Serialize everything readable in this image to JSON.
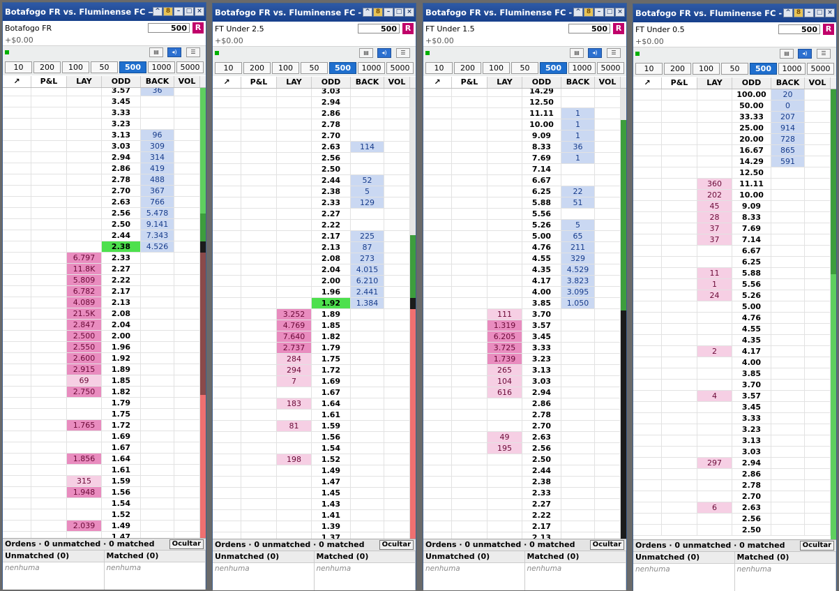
{
  "panels": [
    {
      "title": "Botafogo FR vs. Fluminense FC — Mat...",
      "market": "Botafogo FR",
      "pl": "+$0.00",
      "stake": "500",
      "firstOdd": "3.57",
      "rows": [
        [
          "3.57",
          "",
          "36"
        ],
        [
          "3.45",
          "",
          ""
        ],
        [
          "3.33",
          "",
          ""
        ],
        [
          "3.23",
          "",
          ""
        ],
        [
          "3.13",
          "",
          "96"
        ],
        [
          "3.03",
          "",
          "309"
        ],
        [
          "2.94",
          "",
          "314"
        ],
        [
          "2.86",
          "",
          "419"
        ],
        [
          "2.78",
          "",
          "488"
        ],
        [
          "2.70",
          "",
          "367"
        ],
        [
          "2.63",
          "",
          "766"
        ],
        [
          "2.56",
          "",
          "5.478"
        ],
        [
          "2.50",
          "",
          "9.141"
        ],
        [
          "2.44",
          "",
          "7.343"
        ],
        [
          "2.38",
          "",
          "4.526",
          "cur"
        ],
        [
          "2.33",
          "6.797",
          ""
        ],
        [
          "2.27",
          "11.8K",
          ""
        ],
        [
          "2.22",
          "5.809",
          ""
        ],
        [
          "2.17",
          "6.782",
          ""
        ],
        [
          "2.13",
          "4.089",
          ""
        ],
        [
          "2.08",
          "21.5K",
          ""
        ],
        [
          "2.04",
          "2.847",
          ""
        ],
        [
          "2.00",
          "2.500",
          ""
        ],
        [
          "1.96",
          "2.550",
          ""
        ],
        [
          "1.92",
          "2.600",
          ""
        ],
        [
          "1.89",
          "2.915",
          ""
        ],
        [
          "1.85",
          "69",
          ""
        ],
        [
          "1.82",
          "2.750",
          ""
        ],
        [
          "1.79",
          "",
          ""
        ],
        [
          "1.75",
          "",
          ""
        ],
        [
          "1.72",
          "1.765",
          ""
        ],
        [
          "1.69",
          "",
          ""
        ],
        [
          "1.67",
          "",
          ""
        ],
        [
          "1.64",
          "1.856",
          ""
        ],
        [
          "1.61",
          "",
          ""
        ],
        [
          "1.59",
          "315",
          ""
        ],
        [
          "1.56",
          "1.948",
          ""
        ],
        [
          "1.54",
          "",
          ""
        ],
        [
          "1.52",
          "",
          ""
        ],
        [
          "1.49",
          "2.039",
          ""
        ],
        [
          "1.47",
          "",
          ""
        ]
      ]
    },
    {
      "title": "Botafogo FR vs. Fluminense FC - More...",
      "market": "FT Under 2.5",
      "pl": "+$0.00",
      "stake": "500",
      "rows": [
        [
          "3.03",
          "",
          ""
        ],
        [
          "2.94",
          "",
          ""
        ],
        [
          "2.86",
          "",
          ""
        ],
        [
          "2.78",
          "",
          ""
        ],
        [
          "2.70",
          "",
          ""
        ],
        [
          "2.63",
          "",
          "114"
        ],
        [
          "2.56",
          "",
          ""
        ],
        [
          "2.50",
          "",
          ""
        ],
        [
          "2.44",
          "",
          "52"
        ],
        [
          "2.38",
          "",
          "5"
        ],
        [
          "2.33",
          "",
          "129"
        ],
        [
          "2.27",
          "",
          ""
        ],
        [
          "2.22",
          "",
          ""
        ],
        [
          "2.17",
          "",
          "225"
        ],
        [
          "2.13",
          "",
          "87"
        ],
        [
          "2.08",
          "",
          "273"
        ],
        [
          "2.04",
          "",
          "4.015"
        ],
        [
          "2.00",
          "",
          "6.210"
        ],
        [
          "1.96",
          "",
          "2.441"
        ],
        [
          "1.92",
          "",
          "1.384",
          "cur"
        ],
        [
          "1.89",
          "3.252",
          ""
        ],
        [
          "1.85",
          "4.769",
          ""
        ],
        [
          "1.82",
          "7.640",
          ""
        ],
        [
          "1.79",
          "2.737",
          ""
        ],
        [
          "1.75",
          "284",
          ""
        ],
        [
          "1.72",
          "294",
          ""
        ],
        [
          "1.69",
          "7",
          ""
        ],
        [
          "1.67",
          "",
          ""
        ],
        [
          "1.64",
          "183",
          ""
        ],
        [
          "1.61",
          "",
          ""
        ],
        [
          "1.59",
          "81",
          ""
        ],
        [
          "1.56",
          "",
          ""
        ],
        [
          "1.54",
          "",
          ""
        ],
        [
          "1.52",
          "198",
          ""
        ],
        [
          "1.49",
          "",
          ""
        ],
        [
          "1.47",
          "",
          ""
        ],
        [
          "1.45",
          "",
          ""
        ],
        [
          "1.43",
          "",
          ""
        ],
        [
          "1.41",
          "",
          ""
        ],
        [
          "1.39",
          "",
          ""
        ],
        [
          "1.37",
          "",
          ""
        ]
      ]
    },
    {
      "title": "Botafogo FR vs. Fluminense FC - More...",
      "market": "FT Under 1.5",
      "pl": "+$0.00",
      "stake": "500",
      "rows": [
        [
          "14.29",
          "",
          ""
        ],
        [
          "12.50",
          "",
          ""
        ],
        [
          "11.11",
          "",
          "1"
        ],
        [
          "10.00",
          "",
          "1"
        ],
        [
          "9.09",
          "",
          "1"
        ],
        [
          "8.33",
          "",
          "36"
        ],
        [
          "7.69",
          "",
          "1"
        ],
        [
          "7.14",
          "",
          ""
        ],
        [
          "6.67",
          "",
          ""
        ],
        [
          "6.25",
          "",
          "22"
        ],
        [
          "5.88",
          "",
          "51"
        ],
        [
          "5.56",
          "",
          ""
        ],
        [
          "5.26",
          "",
          "5"
        ],
        [
          "5.00",
          "",
          "65"
        ],
        [
          "4.76",
          "",
          "211"
        ],
        [
          "4.55",
          "",
          "329"
        ],
        [
          "4.35",
          "",
          "4.529"
        ],
        [
          "4.17",
          "",
          "3.823"
        ],
        [
          "4.00",
          "",
          "3.095"
        ],
        [
          "3.85",
          "",
          "1.050"
        ],
        [
          "3.70",
          "111",
          ""
        ],
        [
          "3.57",
          "1.319",
          ""
        ],
        [
          "3.45",
          "6.205",
          ""
        ],
        [
          "3.33",
          "3.725",
          ""
        ],
        [
          "3.23",
          "1.739",
          ""
        ],
        [
          "3.13",
          "265",
          ""
        ],
        [
          "3.03",
          "104",
          ""
        ],
        [
          "2.94",
          "616",
          ""
        ],
        [
          "2.86",
          "",
          ""
        ],
        [
          "2.78",
          "",
          ""
        ],
        [
          "2.70",
          "",
          ""
        ],
        [
          "2.63",
          "49",
          ""
        ],
        [
          "2.56",
          "195",
          ""
        ],
        [
          "2.50",
          "",
          ""
        ],
        [
          "2.44",
          "",
          ""
        ],
        [
          "2.38",
          "",
          ""
        ],
        [
          "2.33",
          "",
          ""
        ],
        [
          "2.27",
          "",
          ""
        ],
        [
          "2.22",
          "",
          ""
        ],
        [
          "2.17",
          "",
          ""
        ],
        [
          "2.13",
          "",
          ""
        ]
      ]
    },
    {
      "title": "Botafogo FR vs. Fluminense FC - More...",
      "market": "FT Under 0.5",
      "pl": "+$0.00",
      "stake": "500",
      "rows": [
        [
          "100.00",
          "",
          "20"
        ],
        [
          "50.00",
          "",
          "0"
        ],
        [
          "33.33",
          "",
          "207"
        ],
        [
          "25.00",
          "",
          "914"
        ],
        [
          "20.00",
          "",
          "728"
        ],
        [
          "16.67",
          "",
          "865"
        ],
        [
          "14.29",
          "",
          "591"
        ],
        [
          "12.50",
          "",
          ""
        ],
        [
          "11.11",
          "360",
          ""
        ],
        [
          "10.00",
          "202",
          ""
        ],
        [
          "9.09",
          "45",
          ""
        ],
        [
          "8.33",
          "28",
          ""
        ],
        [
          "7.69",
          "37",
          ""
        ],
        [
          "7.14",
          "37",
          ""
        ],
        [
          "6.67",
          "",
          ""
        ],
        [
          "6.25",
          "",
          ""
        ],
        [
          "5.88",
          "11",
          ""
        ],
        [
          "5.56",
          "1",
          ""
        ],
        [
          "5.26",
          "24",
          ""
        ],
        [
          "5.00",
          "",
          ""
        ],
        [
          "4.76",
          "",
          ""
        ],
        [
          "4.55",
          "",
          ""
        ],
        [
          "4.35",
          "",
          ""
        ],
        [
          "4.17",
          "2",
          ""
        ],
        [
          "4.00",
          "",
          ""
        ],
        [
          "3.85",
          "",
          ""
        ],
        [
          "3.70",
          "",
          ""
        ],
        [
          "3.57",
          "4",
          ""
        ],
        [
          "3.45",
          "",
          ""
        ],
        [
          "3.33",
          "",
          ""
        ],
        [
          "3.23",
          "",
          ""
        ],
        [
          "3.13",
          "",
          ""
        ],
        [
          "3.03",
          "",
          ""
        ],
        [
          "2.94",
          "297",
          ""
        ],
        [
          "2.86",
          "",
          ""
        ],
        [
          "2.78",
          "",
          ""
        ],
        [
          "2.70",
          "",
          ""
        ],
        [
          "2.63",
          "6",
          ""
        ],
        [
          "2.56",
          "",
          ""
        ],
        [
          "2.50",
          "",
          ""
        ]
      ]
    }
  ],
  "stakes": [
    "10",
    "200",
    "100",
    "50",
    "500",
    "1000",
    "5000"
  ],
  "selected_stake": "500",
  "headers": [
    "P&L",
    "LAY",
    "ODD",
    "BACK",
    "VOL"
  ],
  "orders": {
    "summary": "Ordens · 0 unmatched · 0 matched",
    "hide": "Ocultar",
    "unmatched": "Unmatched (0)",
    "matched": "Matched (0)",
    "none": "nenhuma"
  },
  "reset_label": "R"
}
